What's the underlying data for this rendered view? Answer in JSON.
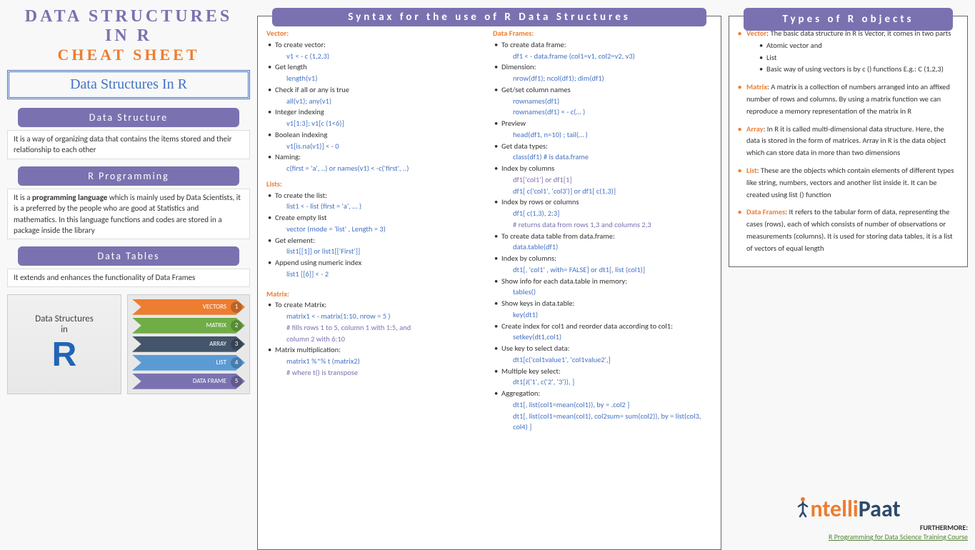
{
  "title": {
    "line1": "DATA STRUCTURES",
    "line2": "IN R",
    "line3": "CHEAT SHEET"
  },
  "subtitle": "Data Structures In R",
  "left_sections": {
    "ds": {
      "header": "Data Structure",
      "text": "It is a way of organizing data that contains the items stored and their relationship to each other"
    },
    "rp": {
      "header": "R Programming",
      "text_pre": "It is a ",
      "text_bold": "programming language",
      "text_post": " which is mainly used by Data Scientists, it is a preferred by the people who are good at Statistics and mathematics. In this language functions and codes are stored in a package inside the library"
    },
    "dt": {
      "header": "Data Tables",
      "text": "It extends and enhances the functionality of Data Frames"
    }
  },
  "diagram": {
    "title_l1": "Data Structures",
    "title_l2": "in",
    "items": [
      "VECTORS",
      "MATRIX",
      "ARRAY",
      "LIST",
      "DATA FRAME"
    ]
  },
  "syntax": {
    "banner": "Syntax for the use of R Data Structures",
    "vector": {
      "title": "Vector:",
      "create": "To create vector:",
      "create_code": "v1 < - c (1,2,3)",
      "length": "Get length",
      "length_code": "length(v1)",
      "check": "Check if all or any is true",
      "check_code": "all(v1); any(v1)",
      "intidx": "Integer indexing",
      "intidx_code": "v1[1:3]; v1[c (1<6)]",
      "boolidx": "Boolean indexing",
      "boolidx_code": "v1[is.na(v1)] < - 0",
      "naming": "Naming:",
      "naming_code": "c(first = 'a', ..) or names(v1) < -c('first', ..)"
    },
    "lists": {
      "title": "Lists:",
      "create": "To create the list:",
      "create_code": "list1 < - list (first = 'a', … )",
      "empty": "Create empty list",
      "empty_code": "vector (mode = 'list' , Length = 3)",
      "get": "Get element:",
      "get_code": "list1[[1]] or list1[['First']]",
      "append": "Append using numeric index",
      "append_code": "list1 [[6]] < - 2"
    },
    "matrix": {
      "title": "Matrix:",
      "create": "To create Matrix:",
      "create_code": "matrix1 < - matrix(1:10, nrow = 5 )",
      "create_note1": "# fills rows 1 to 5, column 1 with 1:5, and",
      "create_note2": "column 2 with 6:10",
      "mult": "Matrix multiplication:",
      "mult_code": "matrix1 %*% t (matrix2)",
      "mult_note": "# where t() is transpose"
    },
    "df": {
      "title": "Data Frames:",
      "create": "To create data frame:",
      "create_code": "df1 < - data.frame (col1=v1, col2=v2, v3)",
      "dim": "Dimension:",
      "dim_code": "nrow(df1); ncol(df1); dim(df1)",
      "cols": "Get/set column names",
      "cols_code1": "rownames(df1)",
      "cols_code2": "rownames(df1) < - c(… )",
      "preview": "Preview",
      "preview_code": "head(df1, n=10) ; tail(… )",
      "types": "Get data types:",
      "types_code": "class(df1) # is data.frame",
      "idxcol": "Index by columns",
      "idxcol_note": "df1['col1'] or df1[1]",
      "idxcol_code": "df1[ c('col1', 'col3')] or df1[ c(1,3)]",
      "idxrc": "Index by rows or columns",
      "idxrc_code": "df1[ c(1,3), 2:3]",
      "idxrc_note": "# returns data from rows 1,3 and columns 2,3",
      "dt": "To create data table from data.frame:",
      "dt_code": "data.table(df1)",
      "idxcol2": "Index by columns:",
      "idxcol2_code": "dt1[, 'col1' , with= FALSE] or dt1[, list (col1)]",
      "showinfo": "Show info for each data.table in memory:",
      "showinfo_code": "tables()",
      "showkeys": "Show keys in data.table:",
      "showkeys_code": "key(dt1)",
      "createidx": "Create index for col1 and reorder data according to col1:",
      "createidx_code": "setkey(dt1,col1)",
      "usekey": "Use key to select data:",
      "usekey_code": "dt1[c('col1value1', 'col1value2',]",
      "multikey": "Multiple key select:",
      "multikey_code": "dt1[J('1', c('2', '3')), ]",
      "agg": "Aggregation:",
      "agg_code1": "dt1[, list(col1=mean(col1)), by = .col2 ]",
      "agg_code2": "dt1[, list(col1=mean(col1), col2sum= sum(col2)), by = list(col3, col4) ]"
    }
  },
  "types": {
    "banner": "Types of R objects",
    "vector": {
      "name": "Vector",
      "text": ": The basic data structure in R is Vector, it comes in two parts",
      "sub1": "Atomic vector and",
      "sub2": "List",
      "sub3": "Basic way of using vectors is by c () functions E.g.: C (1,2,3)"
    },
    "matrix": {
      "name": "Matrix",
      "text": ": A matrix is a collection of numbers arranged into an affixed number of rows and columns. By using a matrix function we can reproduce a memory representation of the matrix in R"
    },
    "array": {
      "name": "Array",
      "text": ": In R it is called multi-dimensional data structure. Here, the data is stored in the form of matrices. Array in R is the data object which can store data in more than two dimensions"
    },
    "list": {
      "name": "List",
      "text": ": These are the objects which contain elements of different types like string, numbers, vectors and another list inside it. It can be created using list () function"
    },
    "df": {
      "name": "Data Frames",
      "text": ": It refers to the tabular form of data, representing the cases (rows), each of which consists of number of observations or measurements (columns). It is used for storing data tables, it is a list of vectors of equal length"
    }
  },
  "footer": {
    "logo_part1": "ntelli",
    "logo_part2": "Paat",
    "furthermore": "FURTHERMORE:",
    "course": "R Programming for Data Science Training Course"
  }
}
